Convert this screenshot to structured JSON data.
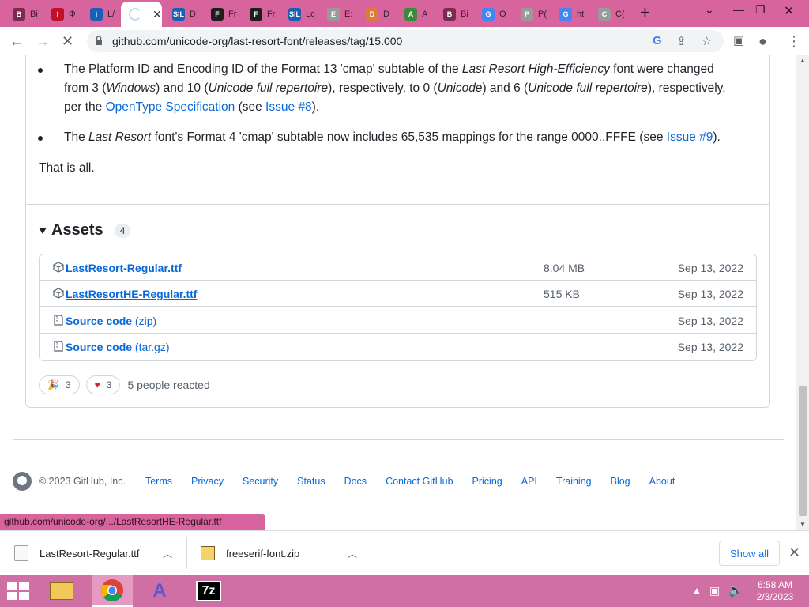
{
  "tabs": [
    {
      "fav": "B",
      "title": "Bi",
      "color": "#7a2b4f"
    },
    {
      "fav": "I",
      "title": "Φ",
      "color": "#c0102a"
    },
    {
      "fav": "i",
      "title": "L/",
      "color": "#1a5fb4"
    },
    {
      "fav": "",
      "title": "",
      "color": "#ffffff",
      "active": true
    },
    {
      "fav": "SIL",
      "title": "D",
      "color": "#1a5fb4"
    },
    {
      "fav": "F",
      "title": "Fr",
      "color": "#1d1d1d"
    },
    {
      "fav": "F",
      "title": "Fr",
      "color": "#1d1d1d"
    },
    {
      "fav": "SIL",
      "title": "Lc",
      "color": "#1a5fb4"
    },
    {
      "fav": "E",
      "title": "E:",
      "color": "#9a9a9a"
    },
    {
      "fav": "D",
      "title": "D",
      "color": "#e07a3a"
    },
    {
      "fav": "A",
      "title": "A",
      "color": "#3a8a3a"
    },
    {
      "fav": "B",
      "title": "Bi",
      "color": "#7a2b4f"
    },
    {
      "fav": "G",
      "title": "O",
      "color": "#4285f4"
    },
    {
      "fav": "P",
      "title": "P(",
      "color": "#9a9a9a"
    },
    {
      "fav": "G",
      "title": "ht",
      "color": "#4285f4"
    },
    {
      "fav": "C",
      "title": "C(",
      "color": "#9a9a9a"
    }
  ],
  "address": {
    "url": "github.com/unicode-org/last-resort-font/releases/tag/15.000"
  },
  "notes": {
    "b1_part1": "The Platform ID and Encoding ID of the Format 13 'cmap' subtable of the ",
    "b1_em1": "Last Resort High-Efficiency",
    "b1_part2": " font were changed from 3 (",
    "b1_em2": "Windows",
    "b1_part3": ") and 10 (",
    "b1_em3": "Unicode full repertoire",
    "b1_part4": "), respectively, to 0 (",
    "b1_em4": "Unicode",
    "b1_part5": ") and 6 (",
    "b1_em5": "Unicode full repertoire",
    "b1_part6": "), respectively, per the ",
    "b1_link1": "OpenType Specification",
    "b1_part7": " (see ",
    "b1_link2": "Issue #8",
    "b1_part8": ").",
    "b2_part1": "The ",
    "b2_em1": "Last Resort",
    "b2_part2": " font's Format 4 'cmap' subtable now includes 65,535 mappings for the range 0000..FFFE (see ",
    "b2_link": "Issue #9",
    "b2_part3": ").",
    "closing": "That is all."
  },
  "assets": {
    "heading": "Assets",
    "count": "4",
    "rows": [
      {
        "name": "LastResort-Regular.ttf",
        "suffix": "",
        "size": "8.04 MB",
        "date": "Sep 13, 2022"
      },
      {
        "name": "LastResortHE-Regular.ttf",
        "suffix": "",
        "size": "515 KB",
        "date": "Sep 13, 2022"
      },
      {
        "name": "Source code",
        "suffix": " (zip)",
        "size": "",
        "date": "Sep 13, 2022"
      },
      {
        "name": "Source code",
        "suffix": " (tar.gz)",
        "size": "",
        "date": "Sep 13, 2022"
      }
    ]
  },
  "reactions": {
    "tada_count": "3",
    "heart_count": "3",
    "people": "5 people reacted"
  },
  "footer": {
    "copyright": "© 2023 GitHub, Inc.",
    "links": [
      "Terms",
      "Privacy",
      "Security",
      "Status",
      "Docs",
      "Contact GitHub",
      "Pricing",
      "API",
      "Training",
      "Blog",
      "About"
    ]
  },
  "status_url": "github.com/unicode-org/.../LastResortHE-Regular.ttf",
  "downloads": {
    "items": [
      "LastResort-Regular.ttf",
      "freeserif-font.zip"
    ],
    "show_all": "Show all"
  },
  "taskbar": {
    "time": "6:58 AM",
    "date": "2/3/2023"
  },
  "colors": {
    "theme": "#d8649e",
    "link": "#0969da",
    "taskbar": "#d06fa3"
  }
}
